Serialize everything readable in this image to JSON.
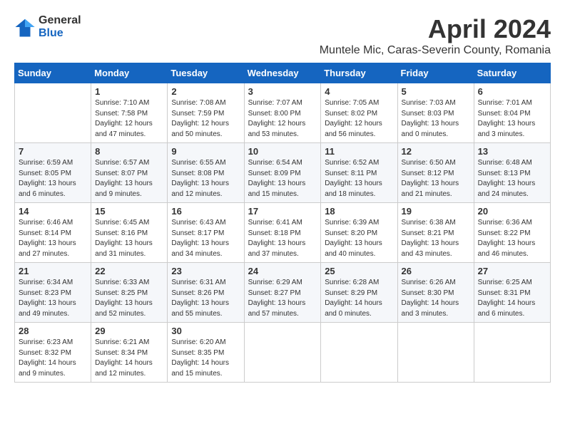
{
  "logo": {
    "general": "General",
    "blue": "Blue"
  },
  "title": "April 2024",
  "subtitle": "Muntele Mic, Caras-Severin County, Romania",
  "columns": [
    "Sunday",
    "Monday",
    "Tuesday",
    "Wednesday",
    "Thursday",
    "Friday",
    "Saturday"
  ],
  "weeks": [
    [
      {
        "day": "",
        "info": ""
      },
      {
        "day": "1",
        "info": "Sunrise: 7:10 AM\nSunset: 7:58 PM\nDaylight: 12 hours\nand 47 minutes."
      },
      {
        "day": "2",
        "info": "Sunrise: 7:08 AM\nSunset: 7:59 PM\nDaylight: 12 hours\nand 50 minutes."
      },
      {
        "day": "3",
        "info": "Sunrise: 7:07 AM\nSunset: 8:00 PM\nDaylight: 12 hours\nand 53 minutes."
      },
      {
        "day": "4",
        "info": "Sunrise: 7:05 AM\nSunset: 8:02 PM\nDaylight: 12 hours\nand 56 minutes."
      },
      {
        "day": "5",
        "info": "Sunrise: 7:03 AM\nSunset: 8:03 PM\nDaylight: 13 hours\nand 0 minutes."
      },
      {
        "day": "6",
        "info": "Sunrise: 7:01 AM\nSunset: 8:04 PM\nDaylight: 13 hours\nand 3 minutes."
      }
    ],
    [
      {
        "day": "7",
        "info": "Sunrise: 6:59 AM\nSunset: 8:05 PM\nDaylight: 13 hours\nand 6 minutes."
      },
      {
        "day": "8",
        "info": "Sunrise: 6:57 AM\nSunset: 8:07 PM\nDaylight: 13 hours\nand 9 minutes."
      },
      {
        "day": "9",
        "info": "Sunrise: 6:55 AM\nSunset: 8:08 PM\nDaylight: 13 hours\nand 12 minutes."
      },
      {
        "day": "10",
        "info": "Sunrise: 6:54 AM\nSunset: 8:09 PM\nDaylight: 13 hours\nand 15 minutes."
      },
      {
        "day": "11",
        "info": "Sunrise: 6:52 AM\nSunset: 8:11 PM\nDaylight: 13 hours\nand 18 minutes."
      },
      {
        "day": "12",
        "info": "Sunrise: 6:50 AM\nSunset: 8:12 PM\nDaylight: 13 hours\nand 21 minutes."
      },
      {
        "day": "13",
        "info": "Sunrise: 6:48 AM\nSunset: 8:13 PM\nDaylight: 13 hours\nand 24 minutes."
      }
    ],
    [
      {
        "day": "14",
        "info": "Sunrise: 6:46 AM\nSunset: 8:14 PM\nDaylight: 13 hours\nand 27 minutes."
      },
      {
        "day": "15",
        "info": "Sunrise: 6:45 AM\nSunset: 8:16 PM\nDaylight: 13 hours\nand 31 minutes."
      },
      {
        "day": "16",
        "info": "Sunrise: 6:43 AM\nSunset: 8:17 PM\nDaylight: 13 hours\nand 34 minutes."
      },
      {
        "day": "17",
        "info": "Sunrise: 6:41 AM\nSunset: 8:18 PM\nDaylight: 13 hours\nand 37 minutes."
      },
      {
        "day": "18",
        "info": "Sunrise: 6:39 AM\nSunset: 8:20 PM\nDaylight: 13 hours\nand 40 minutes."
      },
      {
        "day": "19",
        "info": "Sunrise: 6:38 AM\nSunset: 8:21 PM\nDaylight: 13 hours\nand 43 minutes."
      },
      {
        "day": "20",
        "info": "Sunrise: 6:36 AM\nSunset: 8:22 PM\nDaylight: 13 hours\nand 46 minutes."
      }
    ],
    [
      {
        "day": "21",
        "info": "Sunrise: 6:34 AM\nSunset: 8:23 PM\nDaylight: 13 hours\nand 49 minutes."
      },
      {
        "day": "22",
        "info": "Sunrise: 6:33 AM\nSunset: 8:25 PM\nDaylight: 13 hours\nand 52 minutes."
      },
      {
        "day": "23",
        "info": "Sunrise: 6:31 AM\nSunset: 8:26 PM\nDaylight: 13 hours\nand 55 minutes."
      },
      {
        "day": "24",
        "info": "Sunrise: 6:29 AM\nSunset: 8:27 PM\nDaylight: 13 hours\nand 57 minutes."
      },
      {
        "day": "25",
        "info": "Sunrise: 6:28 AM\nSunset: 8:29 PM\nDaylight: 14 hours\nand 0 minutes."
      },
      {
        "day": "26",
        "info": "Sunrise: 6:26 AM\nSunset: 8:30 PM\nDaylight: 14 hours\nand 3 minutes."
      },
      {
        "day": "27",
        "info": "Sunrise: 6:25 AM\nSunset: 8:31 PM\nDaylight: 14 hours\nand 6 minutes."
      }
    ],
    [
      {
        "day": "28",
        "info": "Sunrise: 6:23 AM\nSunset: 8:32 PM\nDaylight: 14 hours\nand 9 minutes."
      },
      {
        "day": "29",
        "info": "Sunrise: 6:21 AM\nSunset: 8:34 PM\nDaylight: 14 hours\nand 12 minutes."
      },
      {
        "day": "30",
        "info": "Sunrise: 6:20 AM\nSunset: 8:35 PM\nDaylight: 14 hours\nand 15 minutes."
      },
      {
        "day": "",
        "info": ""
      },
      {
        "day": "",
        "info": ""
      },
      {
        "day": "",
        "info": ""
      },
      {
        "day": "",
        "info": ""
      }
    ]
  ]
}
